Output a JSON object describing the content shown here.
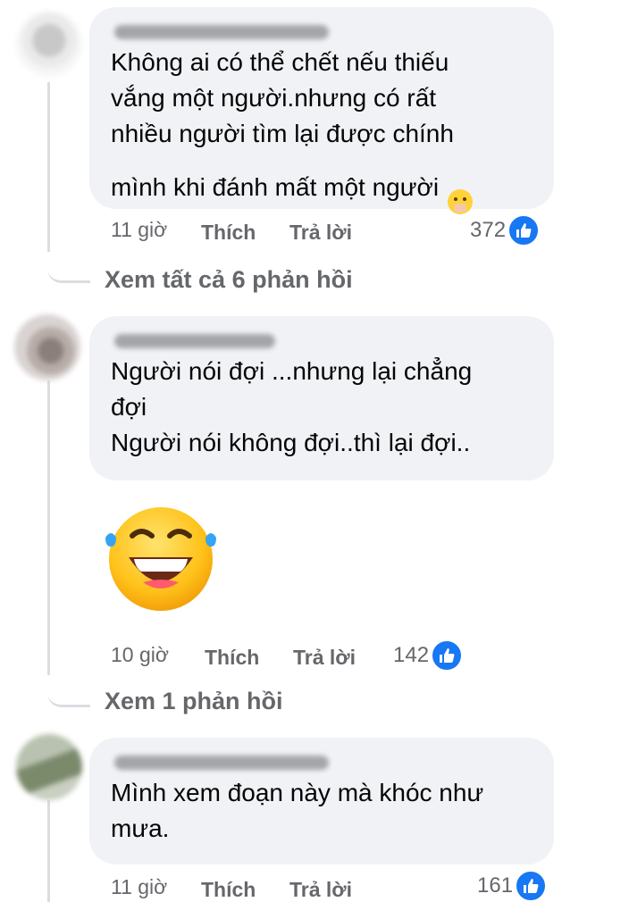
{
  "comments": [
    {
      "text": "Không ai có thể chết nếu thiếu\nvắng một người.nhưng có rất\nnhiều người tìm lại được chính\nmình khi đánh mất một người",
      "time": "11 giờ",
      "like_label": "Thích",
      "reply_label": "Trả lời",
      "reaction_count": "372",
      "view_replies": "Xem tất cả 6 phản hồi"
    },
    {
      "text": "Người nói đợi ...nhưng lại chẳng\nđợi\nNgười nói không đợi..thì lại đợi..",
      "time": "10 giờ",
      "like_label": "Thích",
      "reply_label": "Trả lời",
      "reaction_count": "142",
      "view_replies": "Xem 1 phản hồi"
    },
    {
      "text": "Mình xem đoạn này mà khóc như\nmưa.",
      "time": "11 giờ",
      "like_label": "Thích",
      "reply_label": "Trả lời",
      "reaction_count": "161"
    }
  ],
  "colors": {
    "bubble": "#f0f2f5",
    "meta_text": "#65676b",
    "like_blue": "#1877f2"
  },
  "icons": [
    "face-with-hand-over-mouth-emoji",
    "laughing-tears-sticker",
    "like-thumb-icon"
  ]
}
